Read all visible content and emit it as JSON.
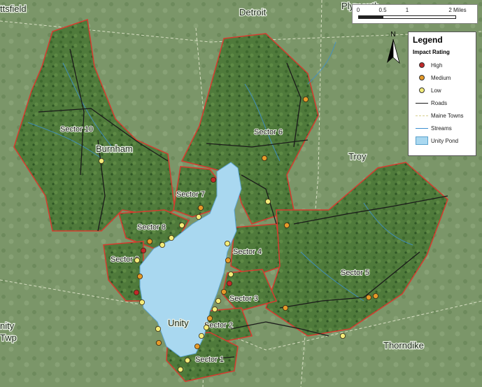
{
  "towns": {
    "pittsfield": "ttsfield",
    "detroit": "Detroit",
    "plymouth": "Plymouth",
    "burnham": "Burnham",
    "troy": "Troy",
    "unity": "Unity",
    "unity_twp_1": "nity",
    "unity_twp_2": "Twp",
    "thorndike": "Thorndike"
  },
  "sectors": [
    "Sector 10",
    "Sector 6",
    "Sector 7",
    "Sector 8",
    "Sector 9",
    "Sector 4",
    "Sector 5",
    "Sector 3",
    "Sector 2",
    "Sector 1"
  ],
  "scale_bar": {
    "ticks": [
      "0",
      "0.5",
      "1",
      "2 Miles"
    ],
    "tick_values": [
      0,
      0.5,
      1,
      2
    ],
    "max_miles": 2
  },
  "north_arrow": {
    "label": "N"
  },
  "legend": {
    "title": "Legend",
    "impact_title": "Impact Rating",
    "items": [
      {
        "label": "High",
        "color": "#c0282a",
        "kind": "point"
      },
      {
        "label": "Medium",
        "color": "#e59a2a",
        "kind": "point"
      },
      {
        "label": "Low",
        "color": "#f3ec7a",
        "kind": "point"
      },
      {
        "label": "Roads",
        "color": "#1a1a1a",
        "kind": "line"
      },
      {
        "label": "Maine Towns",
        "color": "#e8e3b8",
        "kind": "dashed"
      },
      {
        "label": "Streams",
        "color": "#3c8fd0",
        "kind": "line"
      },
      {
        "label": "Unity Pond",
        "color": "#a9d8f0",
        "kind": "fill"
      }
    ]
  },
  "colors": {
    "high": "#c0282a",
    "medium": "#e59a2a",
    "low": "#f3ec7a",
    "sector_boundary": "#d63b2f",
    "pond": "#a9d8f0",
    "road": "#1a1a1a",
    "stream": "#3c8fd0"
  }
}
